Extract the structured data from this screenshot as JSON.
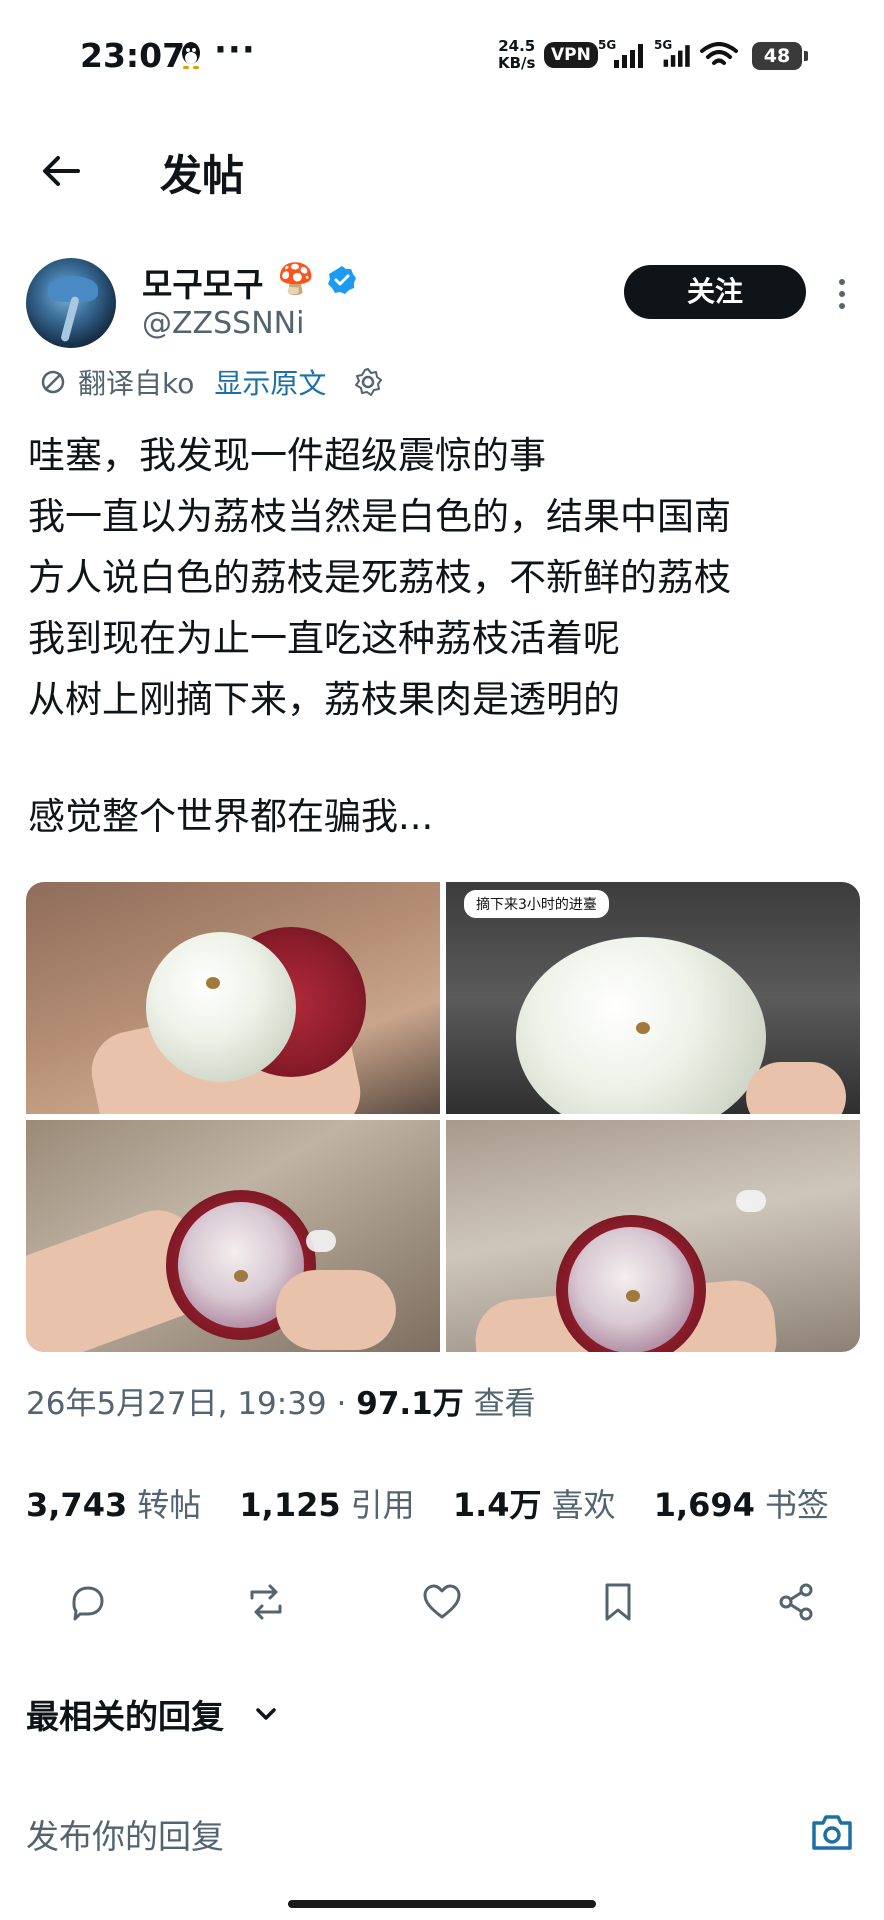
{
  "status_bar": {
    "time": "23:07",
    "menu_dots": "···",
    "speed_value": "24.5",
    "speed_unit": "KB/s",
    "vpn": "VPN",
    "net1": "5G",
    "net2": "5G",
    "battery": "48"
  },
  "header": {
    "title": "发帖"
  },
  "author": {
    "name": "모구모구",
    "emoji": "🍄",
    "handle": "@ZZSSNNi",
    "follow_label": "关注"
  },
  "translation": {
    "label": "翻译自ko",
    "show_original": "显示原文"
  },
  "tweet": {
    "lines": [
      "哇塞，我发现一件超级震惊的事",
      "我一直以为荔枝当然是白色的，结果中国南",
      "方人说白色的荔枝是死荔枝，不新鲜的荔枝",
      "我到现在为止一直吃这种荔枝活着呢",
      "从树上刚摘下来，荔枝果肉是透明的"
    ],
    "last_line": "感觉整个世界都在骗我..."
  },
  "media": {
    "caption_2": "摘下来3小时的进臺"
  },
  "meta": {
    "timestamp": "26年5月27日, 19:39",
    "separator": "·",
    "views": "97.1万",
    "views_label": "查看"
  },
  "stats": {
    "retweets": "3,743",
    "retweets_label": "转帖",
    "quotes": "1,125",
    "quotes_label": "引用",
    "likes": "1.4万",
    "likes_label": "喜欢",
    "bookmarks": "1,694",
    "bookmarks_label": "书签"
  },
  "replies": {
    "sort_label": "最相关的回复",
    "input_placeholder": "发布你的回复"
  }
}
